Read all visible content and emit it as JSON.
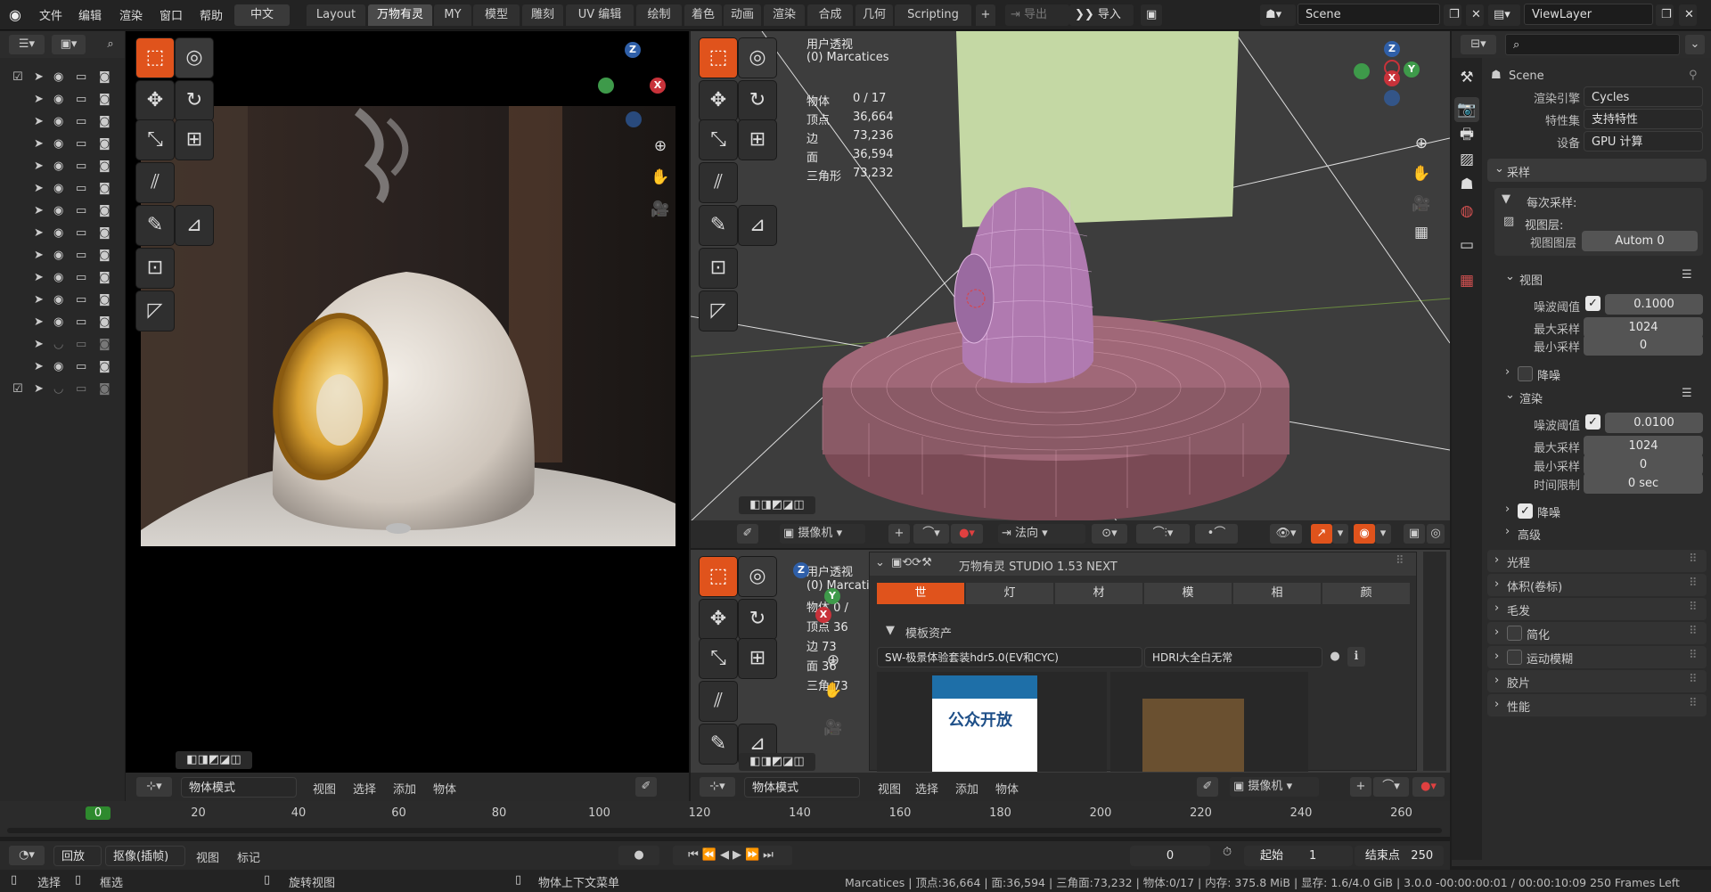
{
  "top_menu": {
    "file": "文件",
    "edit": "编辑",
    "render": "渲染",
    "window": "窗口",
    "help": "帮助",
    "lang": "中文"
  },
  "workspace_tabs": [
    "Layout",
    "万物有灵",
    "MY",
    "模型",
    "雕刻",
    "UV 编辑",
    "绘制",
    "着色",
    "动画",
    "渲染",
    "合成",
    "几何",
    "Scripting"
  ],
  "active_tab_index": 1,
  "top_actions": {
    "export": "导出",
    "import": "导入"
  },
  "scene": {
    "label": "Scene",
    "viewlayer": "ViewLayer"
  },
  "left_viewport": {
    "mode": "物体模式",
    "menus": [
      "视图",
      "选择",
      "添加",
      "物体"
    ]
  },
  "right_viewport": {
    "title": "用户透视",
    "subtitle": "(0) Marcatices",
    "stats": [
      {
        "label": "物体",
        "value": "0 / 17"
      },
      {
        "label": "顶点",
        "value": "36,664"
      },
      {
        "label": "边",
        "value": "73,236"
      },
      {
        "label": "面",
        "value": "36,594"
      },
      {
        "label": "三角形",
        "value": "73,232"
      }
    ],
    "camera": "摄像机",
    "orientation": "法向"
  },
  "mini_viewport": {
    "title": "用户透视",
    "subtitle": "(0) Marcati",
    "stats": [
      "物体 0 /",
      "顶点 36",
      "边 73",
      "面 36",
      "三角 73"
    ],
    "mode": "物体模式",
    "menus": [
      "视图",
      "选择",
      "添加",
      "物体"
    ],
    "camera": "摄像机"
  },
  "plugin_panel": {
    "title": "万物有灵 STUDIO 1.53 NEXT",
    "tabs": [
      "世",
      "灯",
      "材",
      "模",
      "相",
      "颜"
    ],
    "section": "模板资产",
    "preset_left": "SW-极景体验套装hdr5.0(EV和CYC)",
    "preset_right": "HDRI大全白无常",
    "thumb_text": "公众开放"
  },
  "properties": {
    "scene": "Scene",
    "engine_label": "渲染引擎",
    "engine": "Cycles",
    "feature_label": "特性集",
    "feature": "支持特性",
    "device_label": "设备",
    "device": "GPU 计算",
    "sampling": "采样",
    "per_sample": "每次采样:",
    "view_layer": "视图层:",
    "view_layer_label": "视图图层",
    "view_layer_value": "Autom   0",
    "viewport": "视图",
    "noise_threshold_label": "噪波阈值",
    "noise_threshold_vp": "0.1000",
    "max_samples_label": "最大采样",
    "max_samples_vp": "1024",
    "min_samples_label": "最小采样",
    "min_samples_vp": "0",
    "denoise": "降噪",
    "render": "渲染",
    "noise_threshold_r": "0.0100",
    "max_samples_r": "1024",
    "min_samples_r": "0",
    "time_limit_label": "时间限制",
    "time_limit": "0 sec",
    "advanced": "高级",
    "sections": [
      "光程",
      "体积(卷标)",
      "毛发",
      "简化",
      "运动模糊",
      "胶片",
      "性能"
    ]
  },
  "timeline": {
    "current_frame": "0",
    "ticks": [
      "0",
      "20",
      "40",
      "60",
      "80",
      "100",
      "120",
      "140",
      "160",
      "180",
      "200",
      "220",
      "240",
      "260"
    ],
    "playback": "回放",
    "keying": "抠像(插帧)",
    "view": "视图",
    "marker": "标记",
    "frame_display": "0",
    "start_label": "起始",
    "start": "1",
    "end_label": "结束点",
    "end": "250"
  },
  "status_bar": {
    "select": "选择",
    "box_select": "框选",
    "rotate_view": "旋转视图",
    "context_menu": "物体上下文菜单",
    "info": "Marcatices | 顶点:36,664 | 面:36,594 | 三角面:73,232 | 物体:0/17 | 内存: 375.8 MiB | 显存: 1.6/4.0 GiB | 3.0.0   -00:00:00:01 / 00:00:10:09  250 Frames Left"
  },
  "colors": {
    "accent": "#e0531c",
    "header": "#232323",
    "panel": "#303030",
    "viewport_grey": "#3d3d3d",
    "wire": "#d994c4"
  }
}
